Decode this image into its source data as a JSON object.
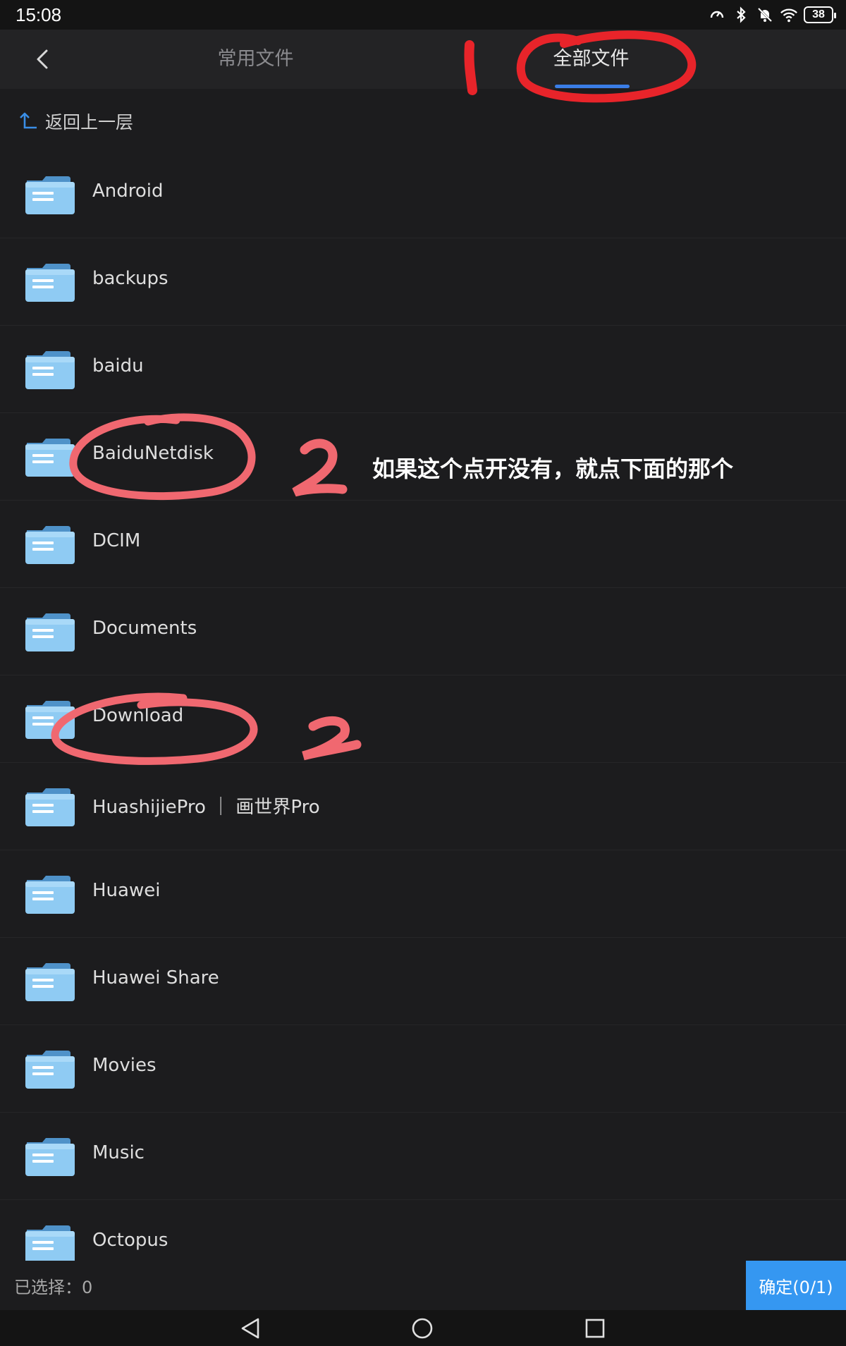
{
  "status_bar": {
    "time": "15:08",
    "battery": "38",
    "icons": [
      "speed-icon",
      "bluetooth-icon",
      "mute-icon",
      "wifi-icon",
      "battery-icon"
    ]
  },
  "header": {
    "tabs": [
      {
        "label": "常用文件",
        "active": false
      },
      {
        "label": "全部文件",
        "active": true
      }
    ],
    "accent_color": "#3a7de6"
  },
  "navigation": {
    "up_level_label": "返回上一层"
  },
  "folders": [
    {
      "name": "Android"
    },
    {
      "name": "backups"
    },
    {
      "name": "baidu"
    },
    {
      "name": "BaiduNetdisk"
    },
    {
      "name": "DCIM"
    },
    {
      "name": "Documents"
    },
    {
      "name": "Download"
    },
    {
      "name": "HuashijiePro ｜ 画世界Pro"
    },
    {
      "name": "Huawei"
    },
    {
      "name": "Huawei Share"
    },
    {
      "name": "Movies"
    },
    {
      "name": "Music"
    },
    {
      "name": "Octopus"
    }
  ],
  "annotations": {
    "step_one": "1",
    "step_two": "2",
    "step_two_b": "2",
    "note": "如果这个点开没有，就点下面的那个",
    "stroke_color": "#e8242a"
  },
  "footer": {
    "selected_label": "已选择：0",
    "confirm_label": "确定(0/1)",
    "confirm_color": "#3597f1"
  }
}
